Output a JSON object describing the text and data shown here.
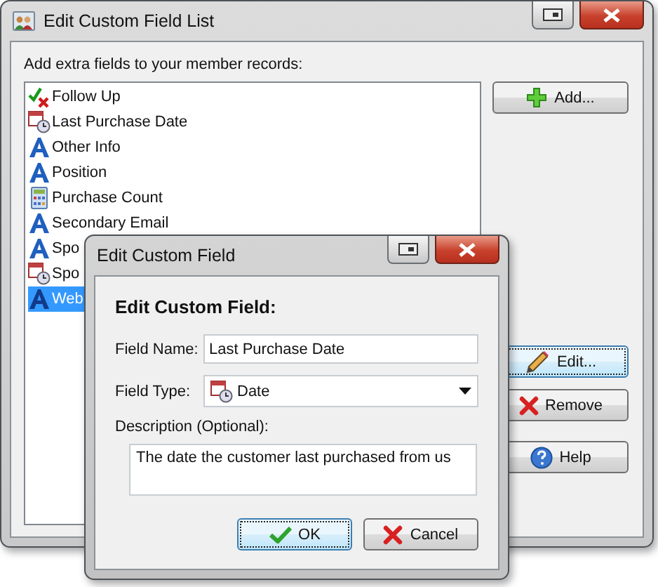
{
  "main_window": {
    "title": "Edit Custom Field List",
    "prompt": "Add extra fields to your member records:",
    "fields": [
      {
        "label": "Follow Up",
        "kind": "yesno",
        "selected": false
      },
      {
        "label": "Last Purchase Date",
        "kind": "date",
        "selected": false
      },
      {
        "label": "Other Info",
        "kind": "text",
        "selected": false
      },
      {
        "label": "Position",
        "kind": "text",
        "selected": false
      },
      {
        "label": "Purchase Count",
        "kind": "number",
        "selected": false
      },
      {
        "label": "Secondary Email",
        "kind": "text",
        "selected": false
      },
      {
        "label": "Spo",
        "kind": "text",
        "selected": false
      },
      {
        "label": "Spo",
        "kind": "date",
        "selected": false
      },
      {
        "label": "Web",
        "kind": "text",
        "selected": true
      }
    ],
    "buttons": [
      {
        "label": "Add...",
        "kind": "add",
        "focused": false
      },
      {
        "label": "Edit...",
        "kind": "edit",
        "focused": true
      },
      {
        "label": "Remove",
        "kind": "remove",
        "focused": false
      },
      {
        "label": "Help",
        "kind": "help",
        "focused": false
      }
    ]
  },
  "dialog": {
    "title": "Edit Custom Field",
    "heading": "Edit Custom Field:",
    "field_name": {
      "label": "Field Name:",
      "value": "Last Purchase Date"
    },
    "field_type": {
      "label": "Field Type:",
      "value": "Date",
      "kind": "date"
    },
    "description": {
      "label": "Description (Optional):",
      "value": "The date the customer last purchased from us"
    },
    "buttons": [
      {
        "label": "OK",
        "kind": "ok",
        "focused": true
      },
      {
        "label": "Cancel",
        "kind": "cancel",
        "focused": false
      }
    ]
  }
}
